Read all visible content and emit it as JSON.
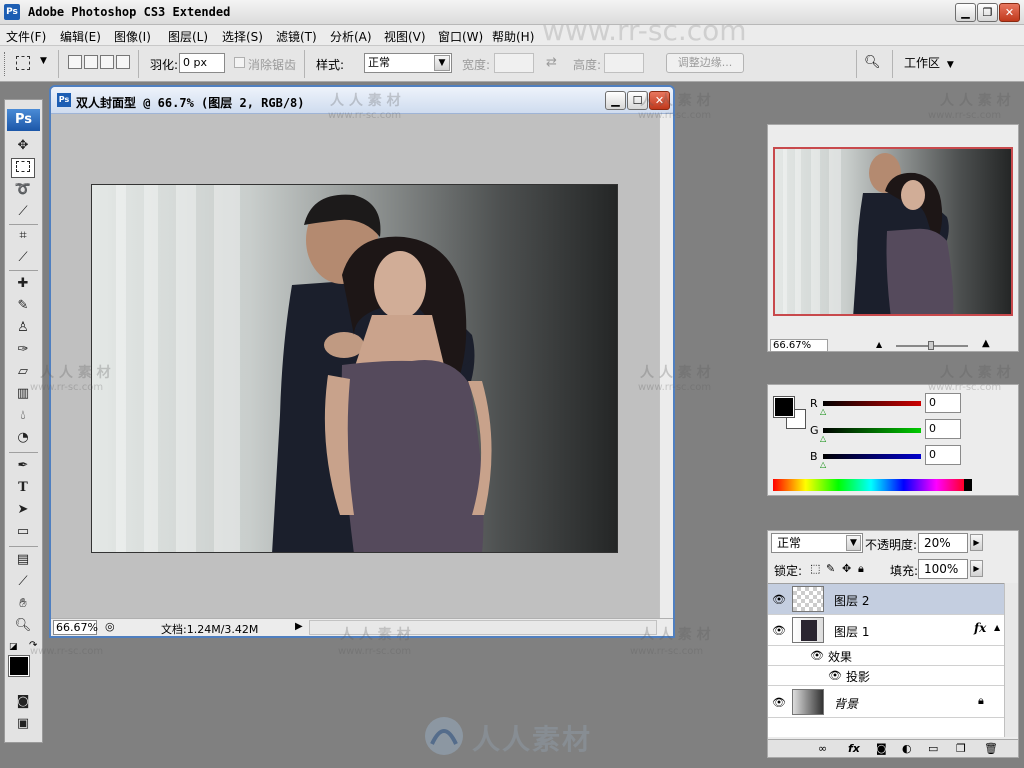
{
  "app": {
    "title": "Adobe Photoshop CS3 Extended",
    "icon_label": "Ps",
    "window_buttons": [
      "minimize",
      "restore",
      "close"
    ]
  },
  "menubar": {
    "items": [
      "文件(F)",
      "编辑(E)",
      "图像(I)",
      "图层(L)",
      "选择(S)",
      "滤镜(T)",
      "分析(A)",
      "视图(V)",
      "窗口(W)",
      "帮助(H)"
    ]
  },
  "options_bar": {
    "feather_label": "羽化:",
    "feather_value": "0 px",
    "antialias_label": "消除锯齿",
    "style_label": "样式:",
    "style_value": "正常",
    "width_label": "宽度:",
    "height_label": "高度:",
    "refine_edge_label": "调整边缘...",
    "workspace_label": "工作区"
  },
  "toolbox": {
    "logo": "Ps",
    "tools": [
      "move-tool",
      "marquee-tool",
      "lasso-tool",
      "magic-wand-tool",
      "crop-tool",
      "slice-tool",
      "healing-brush-tool",
      "brush-tool",
      "clone-stamp-tool",
      "history-brush-tool",
      "eraser-tool",
      "gradient-tool",
      "blur-tool",
      "dodge-tool",
      "pen-tool",
      "type-tool",
      "path-selection-tool",
      "shape-tool",
      "notes-tool",
      "eyedropper-tool",
      "hand-tool",
      "zoom-tool"
    ],
    "type_tool_glyph": "T"
  },
  "document": {
    "title": "双人封面型 @ 66.7% (图层 2, RGB/8)",
    "zoom": "66.67%",
    "doc_info": "文档:1.24M/3.42M"
  },
  "navigator": {
    "zoom": "66.67%"
  },
  "color_panel": {
    "channels": [
      {
        "label": "R",
        "value": "0",
        "color": "#cc0000"
      },
      {
        "label": "G",
        "value": "0",
        "color": "#00b000"
      },
      {
        "label": "B",
        "value": "0",
        "color": "#0000cc"
      }
    ],
    "foreground": "#000000",
    "background": "#ffffff"
  },
  "layers_panel": {
    "blend_mode": "正常",
    "opacity_label": "不透明度:",
    "opacity_value": "20%",
    "lock_label": "锁定:",
    "fill_label": "填充:",
    "fill_value": "100%",
    "layers": [
      {
        "name": "图层 2",
        "selected": true
      },
      {
        "name": "图层 1",
        "selected": false,
        "fx": "fx"
      },
      {
        "name": "效果",
        "selected": false,
        "sub": true
      },
      {
        "name": "投影",
        "selected": false,
        "sub": true
      },
      {
        "name": "背景",
        "selected": false,
        "locked": true
      }
    ]
  },
  "watermark": {
    "text": "人人素材",
    "spaced_text": "人 人 素 材",
    "url": "www.rr-sc.com",
    "top_url": "www.rr-sc.com"
  }
}
